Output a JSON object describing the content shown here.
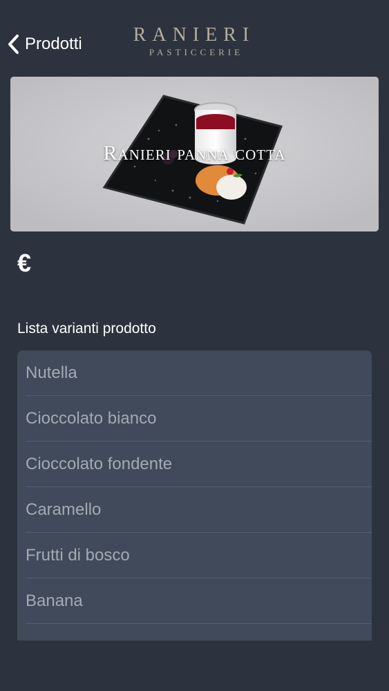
{
  "navbar": {
    "back_label": "Prodotti",
    "brand_name": "RANIERI",
    "brand_subtitle": "PASTICCERIE"
  },
  "hero": {
    "title": "Ranieri panna cotta"
  },
  "price": {
    "currency_symbol": "€"
  },
  "variants": {
    "title": "Lista varianti prodotto",
    "items": [
      {
        "label": "Nutella"
      },
      {
        "label": "Cioccolato bianco"
      },
      {
        "label": "Cioccolato fondente"
      },
      {
        "label": "Caramello"
      },
      {
        "label": "Frutti di bosco"
      },
      {
        "label": "Banana"
      },
      {
        "label": ""
      }
    ]
  },
  "colors": {
    "background": "#2c333e",
    "list_background": "#414a5a",
    "list_text": "#a4aab4",
    "brand": "#b5aca0"
  }
}
